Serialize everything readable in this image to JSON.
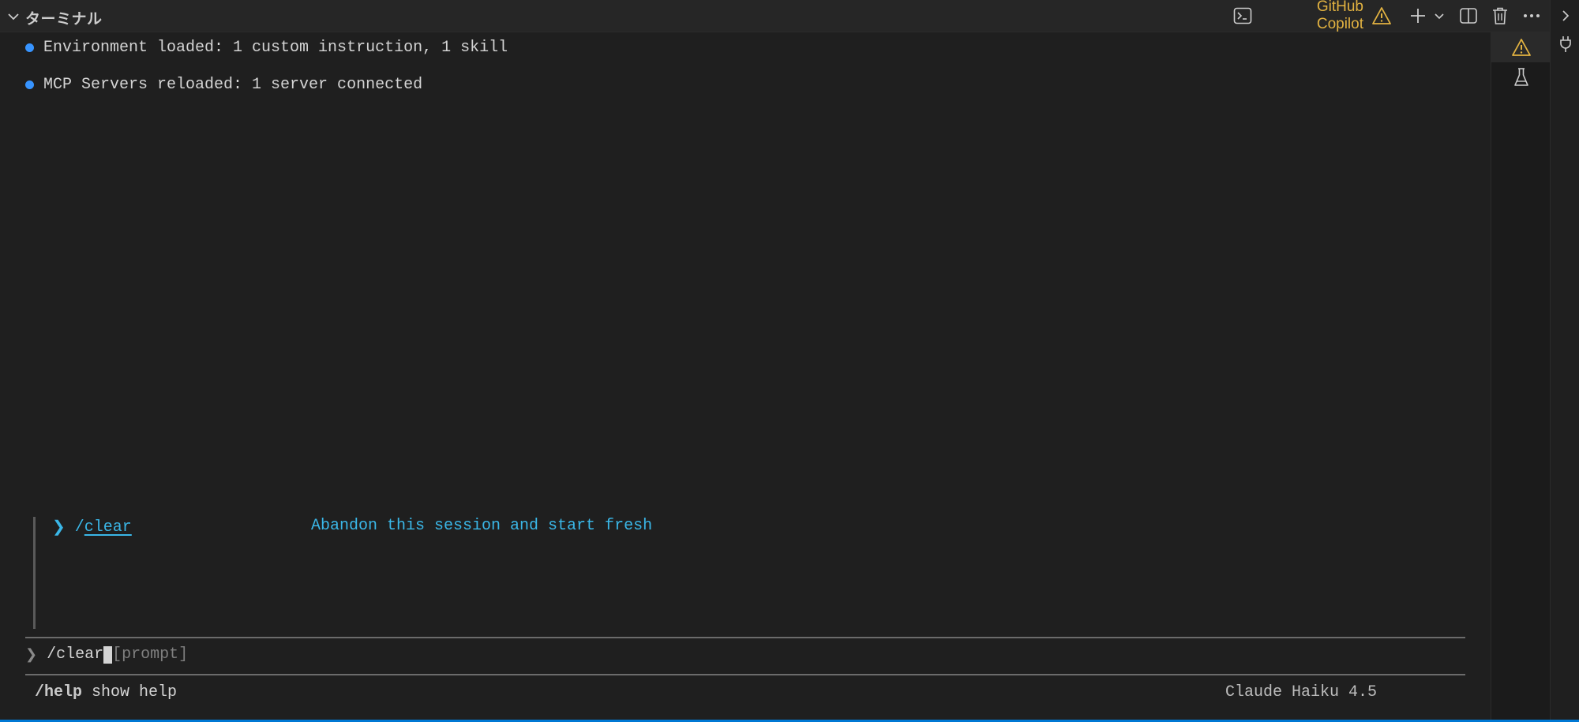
{
  "panel": {
    "title": "ターミナル"
  },
  "toolbar": {
    "profile_label": "GitHub Copilot",
    "icons": [
      "terminal-icon",
      "warning-icon",
      "plus-icon",
      "chevron-down-icon",
      "split-icon",
      "trash-icon",
      "more-icon"
    ]
  },
  "terminal": {
    "messages": [
      {
        "text": "Environment loaded: 1 custom instruction, 1 skill"
      },
      {
        "text": "MCP Servers reloaded: 1 server connected"
      }
    ],
    "completion": {
      "arrow": "❯",
      "slash": "/",
      "command": "clear",
      "description": "Abandon this session and start fresh"
    },
    "prompt": {
      "arrow": "❯",
      "input": "/clear",
      "hint": "[prompt]"
    },
    "footer": {
      "help_command": "/help",
      "help_text": " show help",
      "model": "Claude Haiku 4.5"
    }
  },
  "side_rail": {
    "icons": [
      "warning-icon",
      "flask-icon"
    ]
  },
  "right_strip": {
    "icons": [
      "chevron-right-icon",
      "plug-icon"
    ]
  },
  "colors": {
    "accent": "#0078d4",
    "copilot_warning": "#e3b341",
    "status_dot": "#3794ff",
    "completion": "#3ab7e8"
  }
}
